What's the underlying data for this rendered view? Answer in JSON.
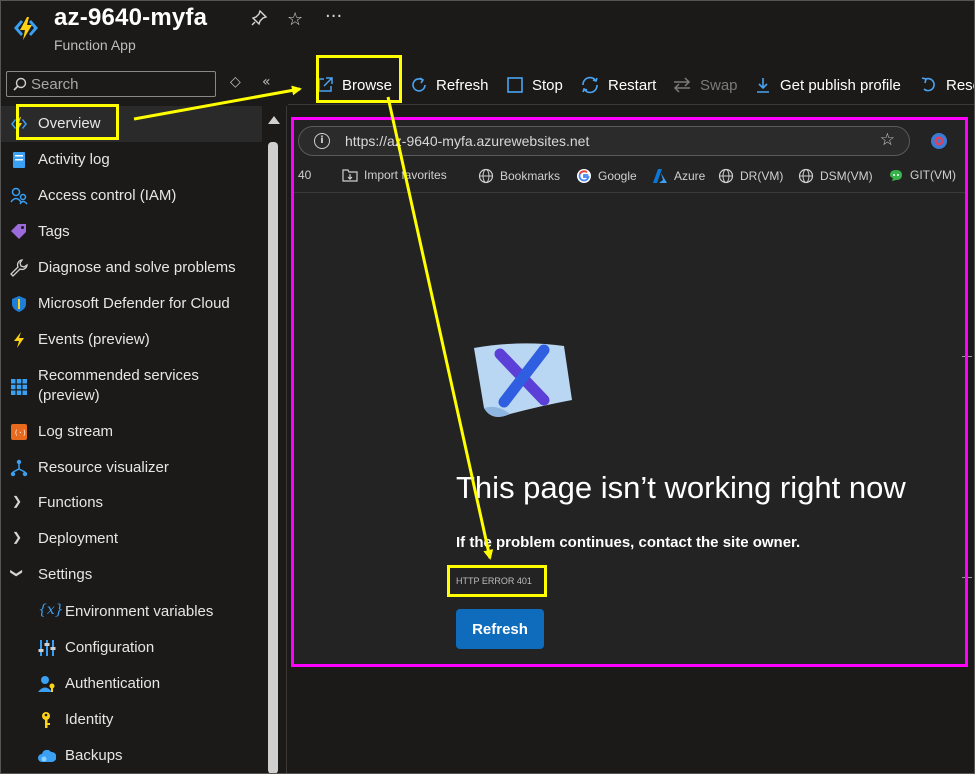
{
  "header": {
    "title": "az-9640-myfa",
    "subtitle": "Function App",
    "pin_icon": "pin-icon",
    "favorite_icon": "star-icon",
    "more_icon": "ellipsis-icon"
  },
  "search": {
    "placeholder": "Search"
  },
  "toolbar": {
    "items": [
      {
        "label": "Browse",
        "icon": "open-external-icon"
      },
      {
        "label": "Refresh",
        "icon": "refresh-icon"
      },
      {
        "label": "Stop",
        "icon": "stop-icon"
      },
      {
        "label": "Restart",
        "icon": "restart-icon"
      },
      {
        "label": "Swap",
        "icon": "swap-icon",
        "disabled": true
      },
      {
        "label": "Get publish profile",
        "icon": "download-icon"
      },
      {
        "label": "Rese",
        "icon": "reset-icon"
      }
    ]
  },
  "sidebar": {
    "items": [
      {
        "label": "Overview",
        "icon": "function-app-icon",
        "selected": true
      },
      {
        "label": "Activity log",
        "icon": "activity-log-icon"
      },
      {
        "label": "Access control (IAM)",
        "icon": "iam-icon"
      },
      {
        "label": "Tags",
        "icon": "tag-icon"
      },
      {
        "label": "Diagnose and solve problems",
        "icon": "wrench-icon"
      },
      {
        "label": "Microsoft Defender for Cloud",
        "icon": "shield-icon"
      },
      {
        "label": "Events (preview)",
        "icon": "lightning-icon"
      },
      {
        "label": "Recommended services (preview)",
        "icon": "grid-icon"
      },
      {
        "label": "Log stream",
        "icon": "log-stream-icon"
      },
      {
        "label": "Resource visualizer",
        "icon": "visualizer-icon"
      },
      {
        "label": "Functions",
        "icon": "chevron-right-icon"
      },
      {
        "label": "Deployment",
        "icon": "chevron-right-icon"
      },
      {
        "label": "Settings",
        "icon": "chevron-down-icon"
      },
      {
        "label": "Environment variables",
        "icon": "variable-icon"
      },
      {
        "label": "Configuration",
        "icon": "sliders-icon"
      },
      {
        "label": "Authentication",
        "icon": "user-key-icon"
      },
      {
        "label": "Identity",
        "icon": "identity-key-icon"
      },
      {
        "label": "Backups",
        "icon": "cloud-backup-icon"
      }
    ]
  },
  "browser": {
    "url": "https://az-9640-myfa.azurewebsites.net",
    "bookmarks": [
      {
        "label": "40"
      },
      {
        "label": "Import favorites",
        "icon": "import-icon"
      },
      {
        "label": "Bookmarks",
        "icon": "globe-icon"
      },
      {
        "label": "Google",
        "icon": "google-icon"
      },
      {
        "label": "Azure",
        "icon": "azure-icon"
      },
      {
        "label": "DR(VM)",
        "icon": "globe-icon"
      },
      {
        "label": "DSM(VM)",
        "icon": "globe-icon"
      },
      {
        "label": "GIT(VM)",
        "icon": "git-icon"
      }
    ],
    "error": {
      "title": "This page isn’t working right now",
      "subtitle": "If the problem continues, contact the site owner.",
      "code": "HTTP ERROR 401",
      "button": "Refresh"
    }
  },
  "colors": {
    "highlight_yellow": "#ffff00",
    "highlight_magenta": "#ff00ff",
    "accent_blue": "#0f6cbd"
  }
}
